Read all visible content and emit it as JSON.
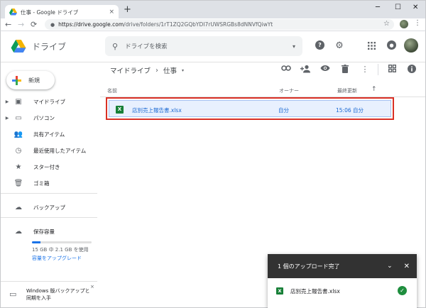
{
  "browser": {
    "tab_title": "仕事 - Google ドライブ",
    "tab_close": "×",
    "new_tab": "+",
    "window_minimize": "─",
    "window_maximize": "☐",
    "window_close": "✕",
    "url_host": "https://drive.google.com",
    "url_path": "/drive/folders/1rT1ZQ2GQbYDI7rUWSRGBs8dNNVfQiwYt",
    "back": "←",
    "forward": "→",
    "reload": "⟳",
    "lock": "🔒",
    "bookmark_star": "☆",
    "menu_dots": "⋮"
  },
  "app": {
    "logo_text": "ドライブ",
    "brand_colors": {
      "green": "#0f9d58",
      "blue": "#4285f4",
      "yellow": "#f4b400",
      "red": "#db4437"
    },
    "search": {
      "placeholder": "ドライブを検索",
      "icon": "search-icon",
      "caret": "▾"
    },
    "top_icons": {
      "help": "?",
      "settings": "⚙",
      "apps": "⋮⋮⋮",
      "notifications": "🔔"
    }
  },
  "sidebar": {
    "new_label": "新規",
    "items": [
      {
        "label": "マイドライブ",
        "icon": "drive-icon",
        "glyph": "▣",
        "caret": "▶"
      },
      {
        "label": "パソコン",
        "icon": "computer-icon",
        "glyph": "▭",
        "caret": "▶"
      },
      {
        "label": "共有アイテム",
        "icon": "people-icon",
        "glyph": "👥",
        "caret": ""
      },
      {
        "label": "最近使用したアイテム",
        "icon": "clock-icon",
        "glyph": "◷",
        "caret": ""
      },
      {
        "label": "スター付き",
        "icon": "star-icon",
        "glyph": "★",
        "caret": ""
      },
      {
        "label": "ゴミ箱",
        "icon": "trash-icon",
        "glyph": "🗑",
        "caret": ""
      }
    ],
    "backup": {
      "label": "バックアップ",
      "icon": "cloud-icon",
      "glyph": "☁"
    },
    "storage": {
      "label": "保存容量",
      "icon": "cloud-outline-icon",
      "glyph": "☁",
      "usage_text": "15 GB 中 2.1 GB を使用",
      "used_fraction": 0.14,
      "upgrade_link": "容量をアップグレード"
    },
    "windows_backup": {
      "text": "Windows 版バックアップと同期を入手",
      "close": "×"
    }
  },
  "toolbar": {
    "breadcrumb_root": "マイドライブ",
    "breadcrumb_sep": "›",
    "breadcrumb_current": "仕事",
    "breadcrumb_caret": "▾",
    "icons": {
      "link": "🔗",
      "share": "👤",
      "preview": "👁",
      "delete": "🗑",
      "more": "⋮",
      "grid": "⊞",
      "info": "ⓘ"
    }
  },
  "file_list": {
    "columns": {
      "name": "名前",
      "owner": "オーナー",
      "modified": "最終更新",
      "sort_arrow": "↑"
    },
    "rows": [
      {
        "type_badge": "X",
        "name": "店別売上報告書.xlsx",
        "owner": "自分",
        "modified": "15:06 自分"
      }
    ]
  },
  "upload_panel": {
    "title": "1 個のアップロード完了",
    "collapse": "⌄",
    "close": "✕",
    "file_badge": "X",
    "file_name": "店別売上報告書.xlsx",
    "status_icon": "✓"
  }
}
